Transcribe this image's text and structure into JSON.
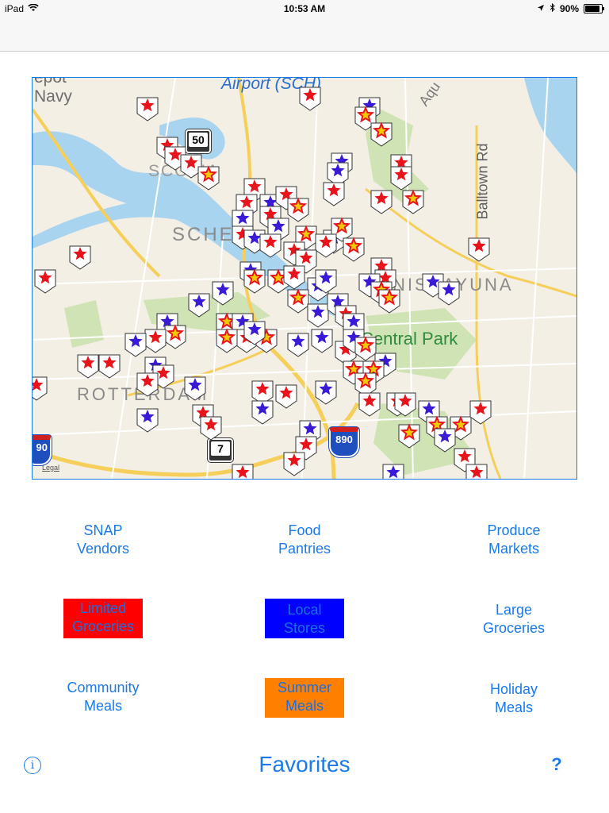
{
  "status_bar": {
    "device": "iPad",
    "time": "10:53 AM",
    "battery": "90%"
  },
  "map": {
    "labels": {
      "airport": "Airport (SCH)",
      "navy": "Navy",
      "depot": "epot",
      "aqu": "Aqu",
      "schenectady_partial": "SCHE",
      "sco_partial": "SCOTIA",
      "niskayuna_partial": "NISKAYUNA",
      "rotterdam": "ROTTERDAM",
      "central_park": "Central Park",
      "balltown_rd": "Balltown Rd",
      "legal": "Legal",
      "shield_50": "50",
      "shield_7": "7",
      "shield_890": "890",
      "shield_90": "90"
    },
    "marker_colors": {
      "red": "#e8141b",
      "blue": "#3a1ad6",
      "gold": "#f2c800"
    }
  },
  "buttons": {
    "snap_vendors": [
      "SNAP",
      "Vendors"
    ],
    "food_pantries": [
      "Food",
      "Pantries"
    ],
    "produce_markets": [
      "Produce",
      "Markets"
    ],
    "limited_groceries": [
      "Limited",
      "Groceries"
    ],
    "local_stores": [
      "Local",
      "Stores"
    ],
    "large_groceries": [
      "Large",
      "Groceries"
    ],
    "community_meals": [
      "Community",
      "Meals"
    ],
    "summer_meals": [
      "Summer",
      "Meals"
    ],
    "holiday_meals": [
      "Holiday",
      "Meals"
    ]
  },
  "bottom": {
    "favorites": "Favorites",
    "info": "i",
    "help": "?"
  },
  "colors": {
    "accent": "#1a7ae8",
    "limited_bg": "#ff0000",
    "local_bg": "#0000ff",
    "summer_bg": "#ff8000"
  }
}
